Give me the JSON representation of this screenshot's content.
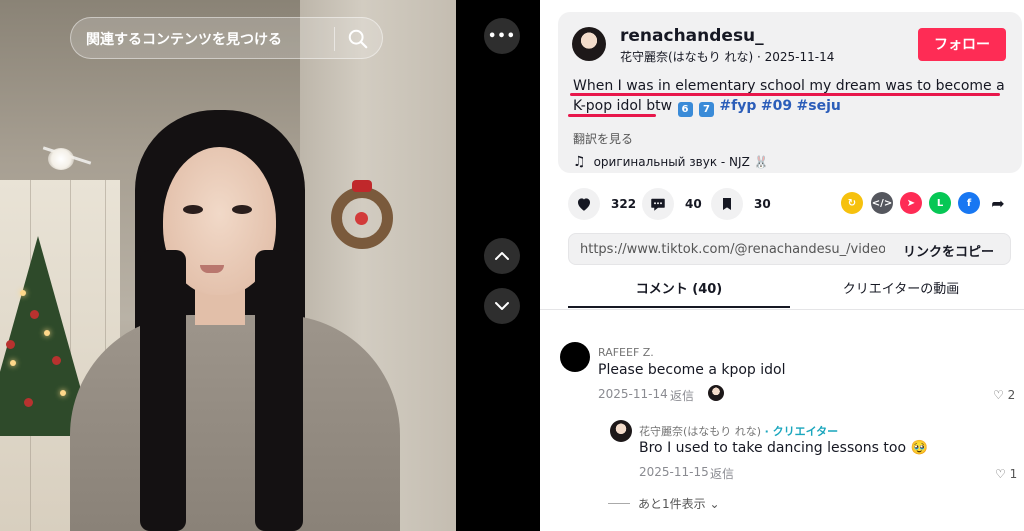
{
  "search": {
    "placeholder": "関連するコンテンツを見つける"
  },
  "video": {
    "more_label": "•••"
  },
  "post": {
    "author_username": "renachandesu_",
    "author_display": "花守麗奈(はなもり れな) · 2025-11-14",
    "follow_label": "フォロー",
    "caption_text": "When I was in elementary school my dream was to become a K-pop idol btw",
    "caption_emojis": [
      "6",
      "7"
    ],
    "hashtags": [
      "#fyp",
      "#09",
      "#seju"
    ],
    "translate_label": "翻訳を見る",
    "music_label": "оригинальный звук - NJZ 🐰"
  },
  "actions": {
    "likes": "322",
    "comments": "40",
    "saves": "30"
  },
  "share_icons": [
    "repost-icon",
    "embed-icon",
    "send-icon",
    "line-icon",
    "facebook-icon",
    "share-arrow-icon"
  ],
  "colors": {
    "accent": "#fe2c55",
    "underline": "#e8174b",
    "hashtag": "#2b5db9",
    "creator": "#1aa6bd"
  },
  "link": {
    "url": "https://www.tiktok.com/@renachandesu_/video/7...",
    "copy_label": "リンクをコピー"
  },
  "tabs": {
    "comments": "コメント (40)",
    "creator_videos": "クリエイターの動画"
  },
  "comments": [
    {
      "user": "RAFEEF Z.",
      "text": "Please become a kpop idol",
      "date": "2025-11-14",
      "reply_label": "返信",
      "likes": "2"
    }
  ],
  "reply": {
    "user": "花守麗奈(はなもり れな)",
    "badge": "· クリエイター",
    "text": "Bro I used to take dancing lessons too 🥹",
    "date": "2025-11-15",
    "reply_label": "返信",
    "likes": "1"
  },
  "more_replies_label": "あと1件表示 ⌄"
}
